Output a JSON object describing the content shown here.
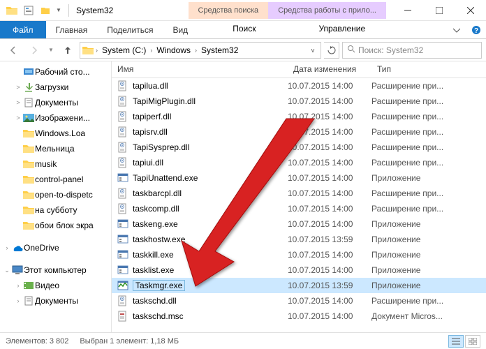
{
  "title": "System32",
  "contextual_tabs": {
    "search": "Средства поиска",
    "app": "Средства работы с прило..."
  },
  "ribbon": {
    "file": "Файл",
    "home": "Главная",
    "share": "Поделиться",
    "view": "Вид",
    "search_sub": "Поиск",
    "app_sub": "Управление"
  },
  "breadcrumbs": [
    "System (C:)",
    "Windows",
    "System32"
  ],
  "search_placeholder": "Поиск: System32",
  "columns": {
    "name": "Имя",
    "date": "Дата изменения",
    "type": "Тип"
  },
  "sidebar": {
    "items": [
      {
        "label": "Рабочий сто...",
        "icon": "desktop",
        "twisty": ""
      },
      {
        "label": "Загрузки",
        "icon": "downloads",
        "twisty": ">"
      },
      {
        "label": "Документы",
        "icon": "documents",
        "twisty": ">"
      },
      {
        "label": "Изображени...",
        "icon": "pictures",
        "twisty": ">"
      },
      {
        "label": "Windows.Loa",
        "icon": "folder",
        "twisty": ""
      },
      {
        "label": "Мельница",
        "icon": "folder",
        "twisty": ""
      },
      {
        "label": "musik",
        "icon": "folder",
        "twisty": ""
      },
      {
        "label": "control-panel",
        "icon": "folder",
        "twisty": ""
      },
      {
        "label": "open-to-dispetc",
        "icon": "folder",
        "twisty": ""
      },
      {
        "label": "на субботу",
        "icon": "folder",
        "twisty": ""
      },
      {
        "label": "обои блок экра",
        "icon": "folder",
        "twisty": ""
      }
    ],
    "onedrive": "OneDrive",
    "thispc": "Этот компьютер",
    "video": "Видео",
    "docs": "Документы"
  },
  "files": [
    {
      "name": "tapilua.dll",
      "date": "10.07.2015 14:00",
      "type": "Расширение при...",
      "icon": "dll"
    },
    {
      "name": "TapiMigPlugin.dll",
      "date": "10.07.2015 14:00",
      "type": "Расширение при...",
      "icon": "dll"
    },
    {
      "name": "tapiperf.dll",
      "date": "10.07.2015 14:00",
      "type": "Расширение при...",
      "icon": "dll"
    },
    {
      "name": "tapisrv.dll",
      "date": "10.07.2015 14:00",
      "type": "Расширение при...",
      "icon": "dll"
    },
    {
      "name": "TapiSysprep.dll",
      "date": "10.07.2015 14:00",
      "type": "Расширение при...",
      "icon": "dll"
    },
    {
      "name": "tapiui.dll",
      "date": "10.07.2015 14:00",
      "type": "Расширение при...",
      "icon": "dll"
    },
    {
      "name": "TapiUnattend.exe",
      "date": "10.07.2015 14:00",
      "type": "Приложение",
      "icon": "exe"
    },
    {
      "name": "taskbarcpl.dll",
      "date": "10.07.2015 14:00",
      "type": "Расширение при...",
      "icon": "dll"
    },
    {
      "name": "taskcomp.dll",
      "date": "10.07.2015 14:00",
      "type": "Расширение при...",
      "icon": "dll"
    },
    {
      "name": "taskeng.exe",
      "date": "10.07.2015 14:00",
      "type": "Приложение",
      "icon": "exe"
    },
    {
      "name": "taskhostw.exe",
      "date": "10.07.2015 13:59",
      "type": "Приложение",
      "icon": "exe"
    },
    {
      "name": "taskkill.exe",
      "date": "10.07.2015 14:00",
      "type": "Приложение",
      "icon": "exe"
    },
    {
      "name": "tasklist.exe",
      "date": "10.07.2015 14:00",
      "type": "Приложение",
      "icon": "exe"
    },
    {
      "name": "Taskmgr.exe",
      "date": "10.07.2015 13:59",
      "type": "Приложение",
      "icon": "taskmgr",
      "selected": true
    },
    {
      "name": "taskschd.dll",
      "date": "10.07.2015 14:00",
      "type": "Расширение при...",
      "icon": "dll"
    },
    {
      "name": "taskschd.msc",
      "date": "10.07.2015 14:00",
      "type": "Документ Micros...",
      "icon": "msc"
    }
  ],
  "status": {
    "count_label": "Элементов:",
    "count": "3 802",
    "sel_label": "Выбран 1 элемент:",
    "sel_size": "1,18 МБ"
  }
}
